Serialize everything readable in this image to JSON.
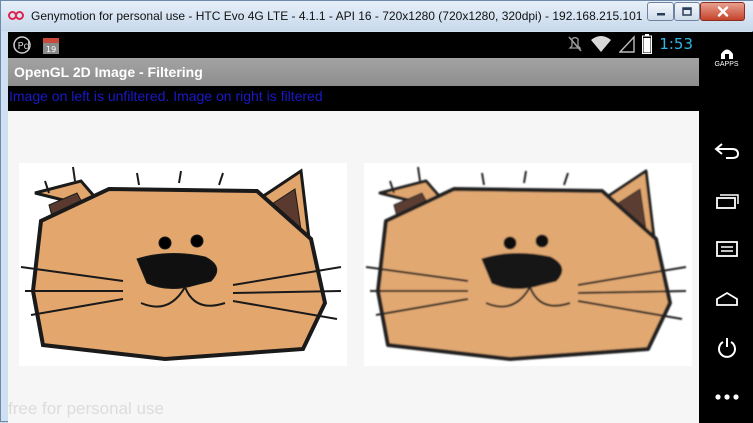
{
  "window": {
    "title": "Genymotion for personal use - HTC Evo 4G LTE - 4.1.1 - API 16 - 720x1280 (720x1280, 320dpi) - 192.168.215.101",
    "controls": [
      "minimize-icon",
      "maximize-icon",
      "close-icon"
    ]
  },
  "statusbar": {
    "left_icons": [
      "usb-debug-icon",
      "calendar-icon"
    ],
    "right_icons": [
      "mute-icon",
      "wifi-icon",
      "signal-icon",
      "battery-icon"
    ],
    "time": "1:53",
    "accent_color": "#33b5e5"
  },
  "app": {
    "title": "OpenGL 2D Image - Filtering",
    "info": "Image on left is unfiltered. Image on right is filtered",
    "info_color": "#1a18c8"
  },
  "watermark": "free for personal use",
  "navbar": {
    "gapps_label": "GAPPS",
    "buttons": [
      "gapps-icon",
      "back-icon",
      "recent-apps-icon",
      "menu-icon",
      "home-icon",
      "power-icon",
      "more-icon"
    ]
  }
}
